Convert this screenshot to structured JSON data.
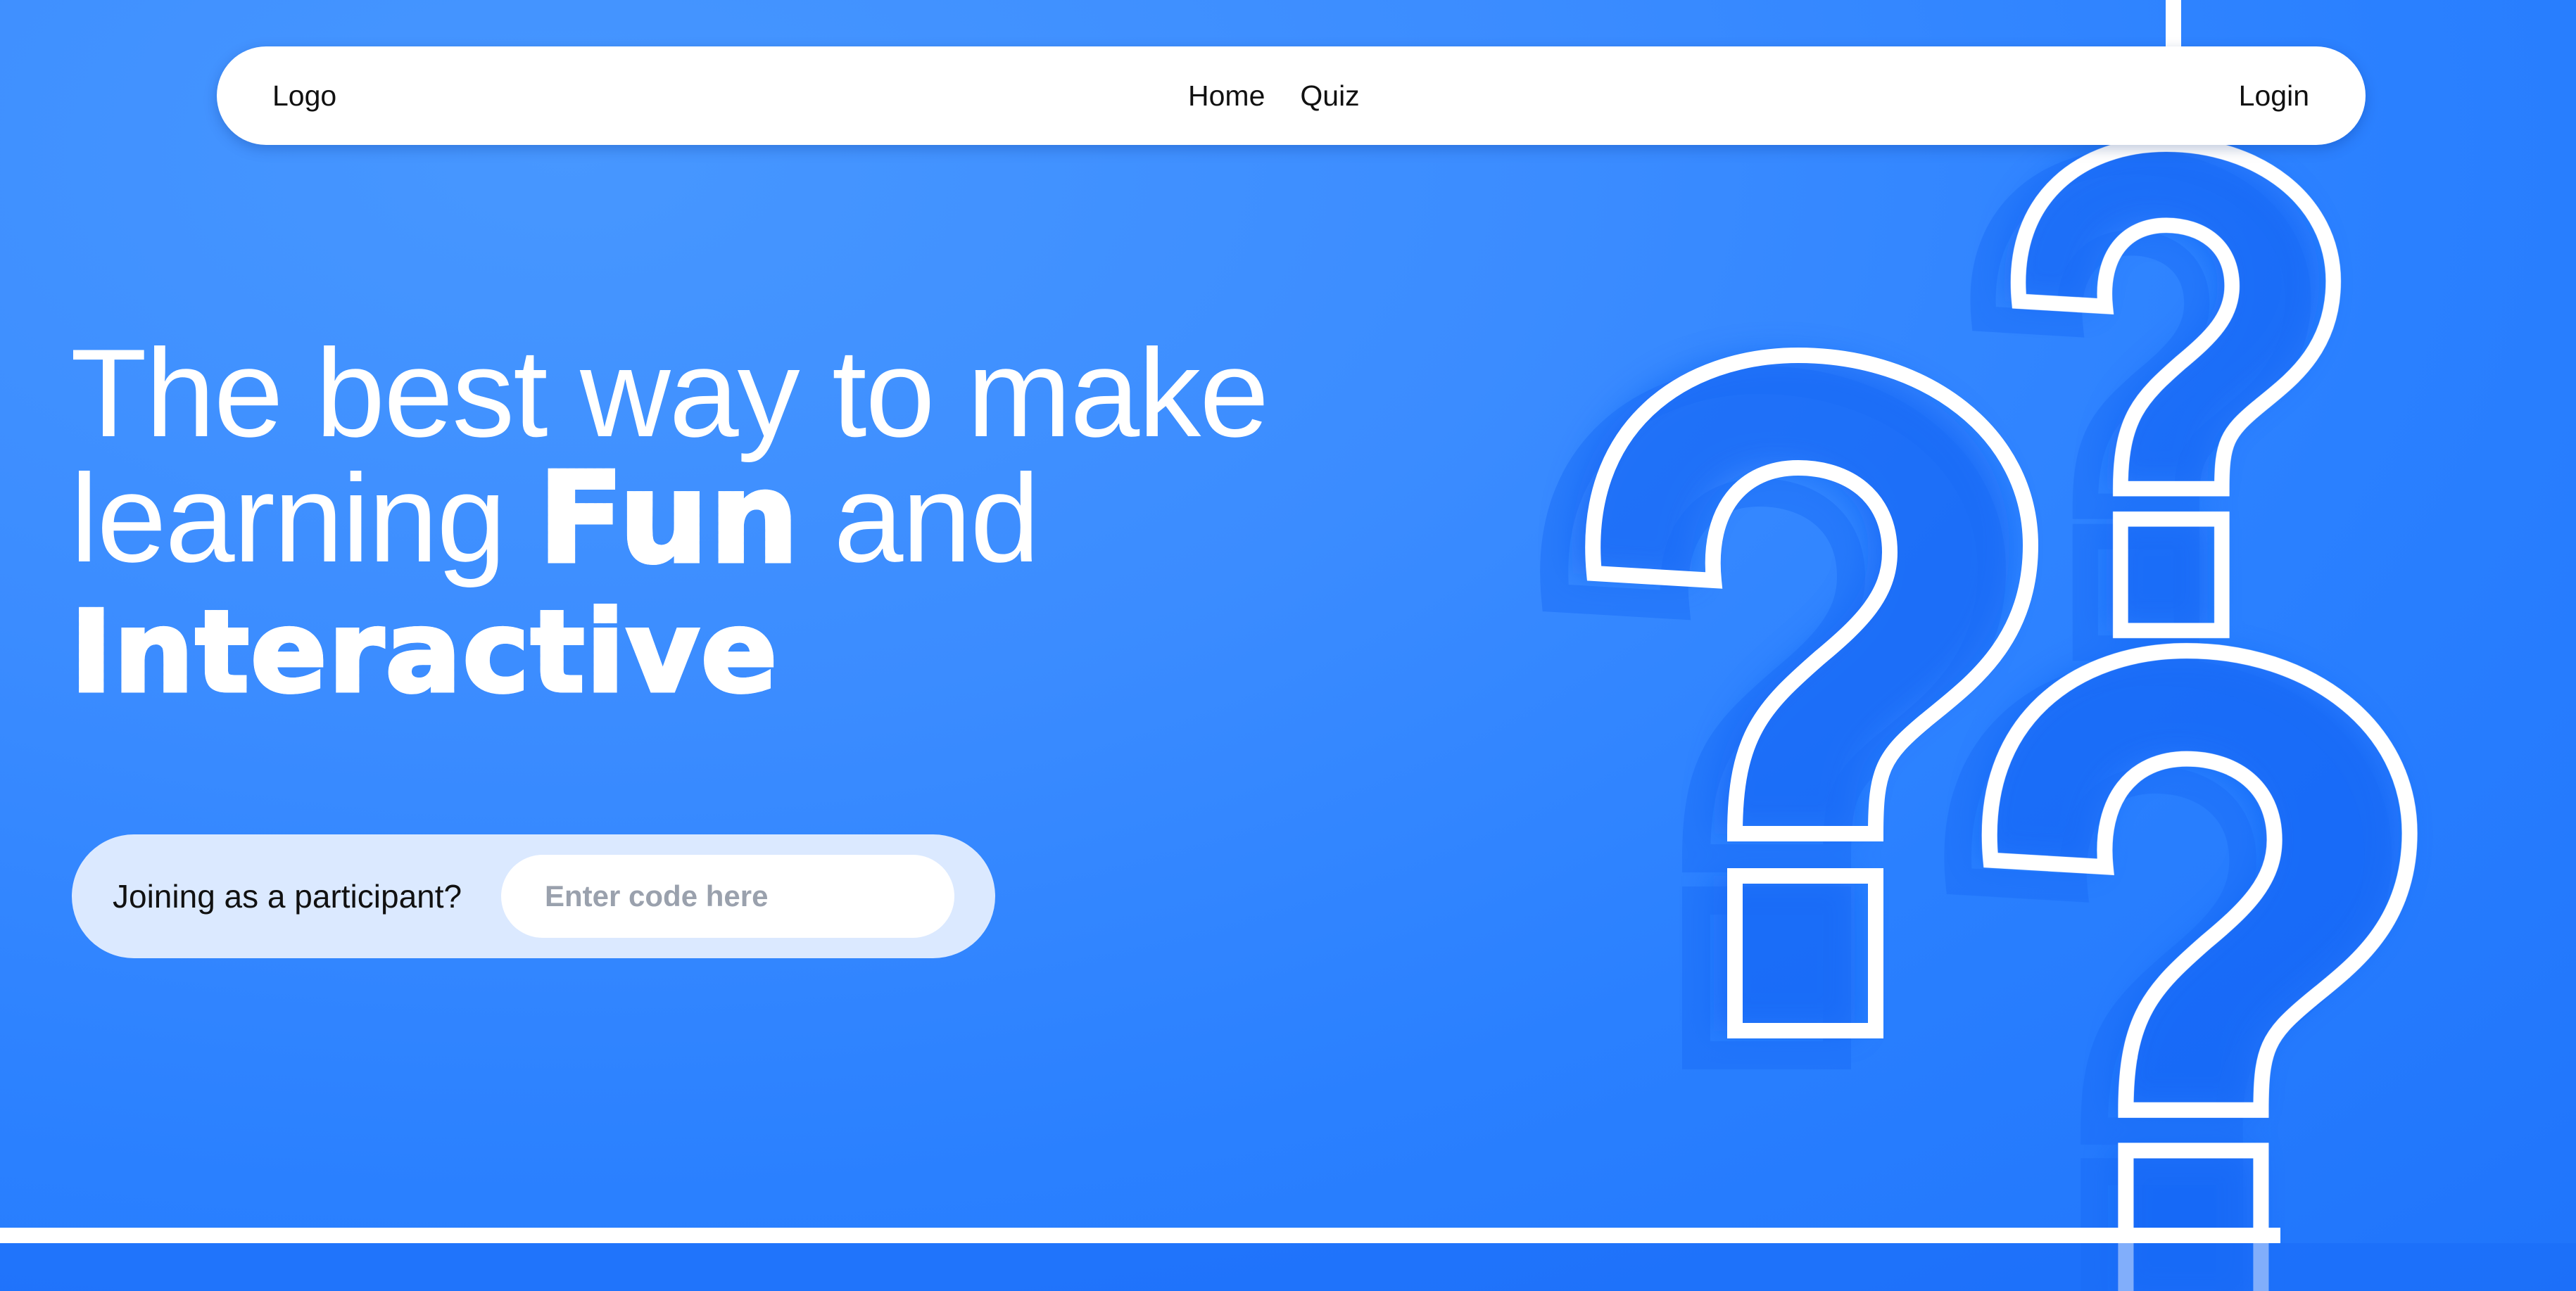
{
  "navbar": {
    "logo": "Logo",
    "links": [
      "Home",
      "Quiz"
    ],
    "login": "Login"
  },
  "hero": {
    "line1": "The best way to make",
    "line2_prefix": "learning ",
    "line2_fancy": "Fun",
    "line2_suffix": " and",
    "line3_fancy": "Interactive"
  },
  "join": {
    "label": "Joining as a participant?",
    "placeholder": "Enter code here",
    "value": ""
  },
  "colors": {
    "background": "#2a80ff",
    "navbar": "#ffffff",
    "join_pill": "#dbe9ff",
    "hero_text": "#ffffff"
  },
  "decorations": [
    "question-mark-large-left",
    "question-mark-top-right",
    "question-mark-bottom-right"
  ]
}
